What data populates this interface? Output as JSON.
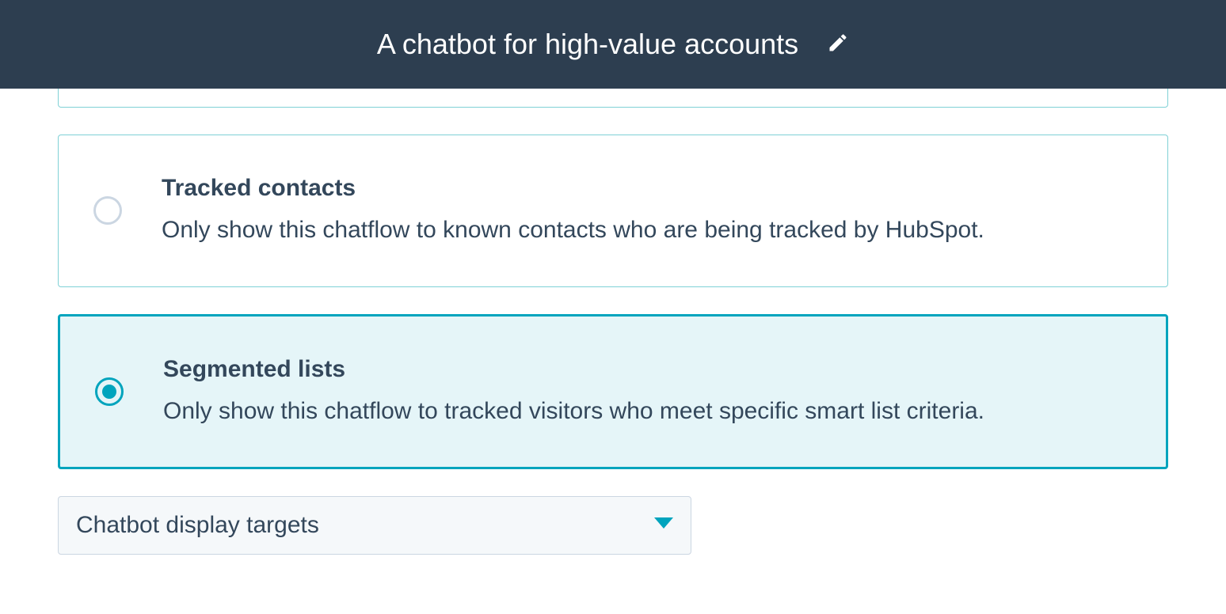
{
  "header": {
    "title": "A chatbot for high-value accounts"
  },
  "options": [
    {
      "title": "Tracked contacts",
      "desc": "Only show this chatflow to known contacts who are being tracked by HubSpot."
    },
    {
      "title": "Segmented lists",
      "desc": "Only show this chatflow to tracked visitors who meet specific smart list criteria."
    }
  ],
  "dropdown": {
    "label": "Chatbot display targets"
  }
}
